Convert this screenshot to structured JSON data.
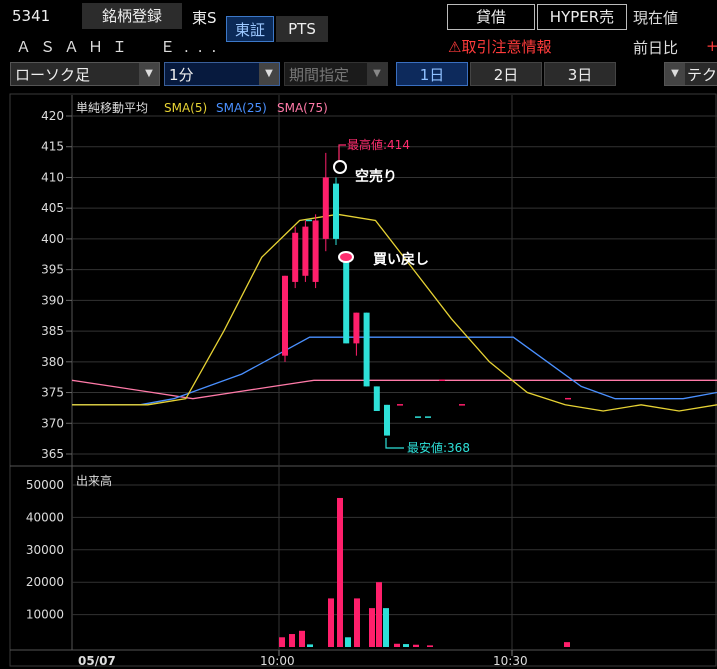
{
  "header": {
    "stock_code": "5341",
    "stock_name": "ＡＳＡＨＩ　Ｅ...",
    "register_label": "銘柄登録",
    "market_label": "東S",
    "tse_label": "東証",
    "pts_label": "PTS",
    "lend_label": "貸借",
    "hyper_label": "HYPER売",
    "current_price_label": "現在値",
    "prev_change_label": "前日比",
    "prev_change_sign": "+",
    "warning_text": "取引注意情報"
  },
  "toolbar": {
    "chart_type": "ローソク足",
    "interval": "1分",
    "period": "期間指定",
    "days": [
      "1日",
      "2日",
      "3日"
    ],
    "extra": "テク"
  },
  "colors": {
    "up": "#ff1f6b",
    "down": "#2ee0d8",
    "sma5": "#e6d234",
    "sma25": "#4a90ff",
    "sma75": "#ff7aa8",
    "grid": "#333333"
  },
  "chart_data": [
    {
      "type": "candlestick",
      "title": "単純移動平均",
      "legend": [
        "SMA(5)",
        "SMA(25)",
        "SMA(75)"
      ],
      "ylim": [
        365,
        420
      ],
      "yticks": [
        420,
        415,
        410,
        405,
        400,
        395,
        390,
        385,
        380,
        375,
        370,
        365
      ],
      "annotations": {
        "high": "最高値:414",
        "low": "最安値:368",
        "sell": "空売り",
        "buyback": "買い戻し"
      },
      "candles": [
        {
          "o": 381,
          "h": 394,
          "l": 380,
          "c": 394
        },
        {
          "o": 393,
          "h": 402,
          "l": 392,
          "c": 401
        },
        {
          "o": 394,
          "h": 403,
          "l": 393,
          "c": 402
        },
        {
          "o": 393,
          "h": 404,
          "l": 392,
          "c": 403
        },
        {
          "o": 400,
          "h": 414,
          "l": 398,
          "c": 410
        },
        {
          "o": 409,
          "h": 410,
          "l": 399,
          "c": 400
        },
        {
          "o": 397,
          "h": 397,
          "l": 383,
          "c": 383
        },
        {
          "o": 383,
          "h": 388,
          "l": 381,
          "c": 388
        },
        {
          "o": 388,
          "h": 388,
          "l": 376,
          "c": 376
        },
        {
          "o": 376,
          "h": 376,
          "l": 372,
          "c": 372
        },
        {
          "o": 373,
          "h": 373,
          "l": 368,
          "c": 368
        }
      ],
      "sma5": [
        373,
        373,
        373,
        374,
        385,
        397,
        403,
        404,
        403,
        395,
        387,
        380,
        375,
        373,
        372,
        373,
        372,
        373
      ],
      "sma25": [
        373,
        373,
        373,
        374,
        376,
        378,
        381,
        384,
        384,
        384,
        384,
        384,
        384,
        384,
        380,
        376,
        374,
        374,
        374,
        375
      ],
      "sma75": [
        377,
        376,
        375,
        374,
        375,
        376,
        377,
        377,
        377,
        377,
        377,
        377,
        377,
        377,
        377,
        377,
        377
      ]
    },
    {
      "type": "bar",
      "title": "出来高",
      "ylim": [
        0,
        55000
      ],
      "yticks": [
        50000,
        40000,
        30000,
        20000,
        10000
      ],
      "xticks": [
        "05/07",
        "10:00",
        "10:30"
      ],
      "values": [
        3000,
        4000,
        5000,
        800,
        15000,
        46000,
        3000,
        15000,
        12000,
        20000,
        12000,
        1000,
        900,
        700,
        500,
        1500
      ]
    }
  ]
}
